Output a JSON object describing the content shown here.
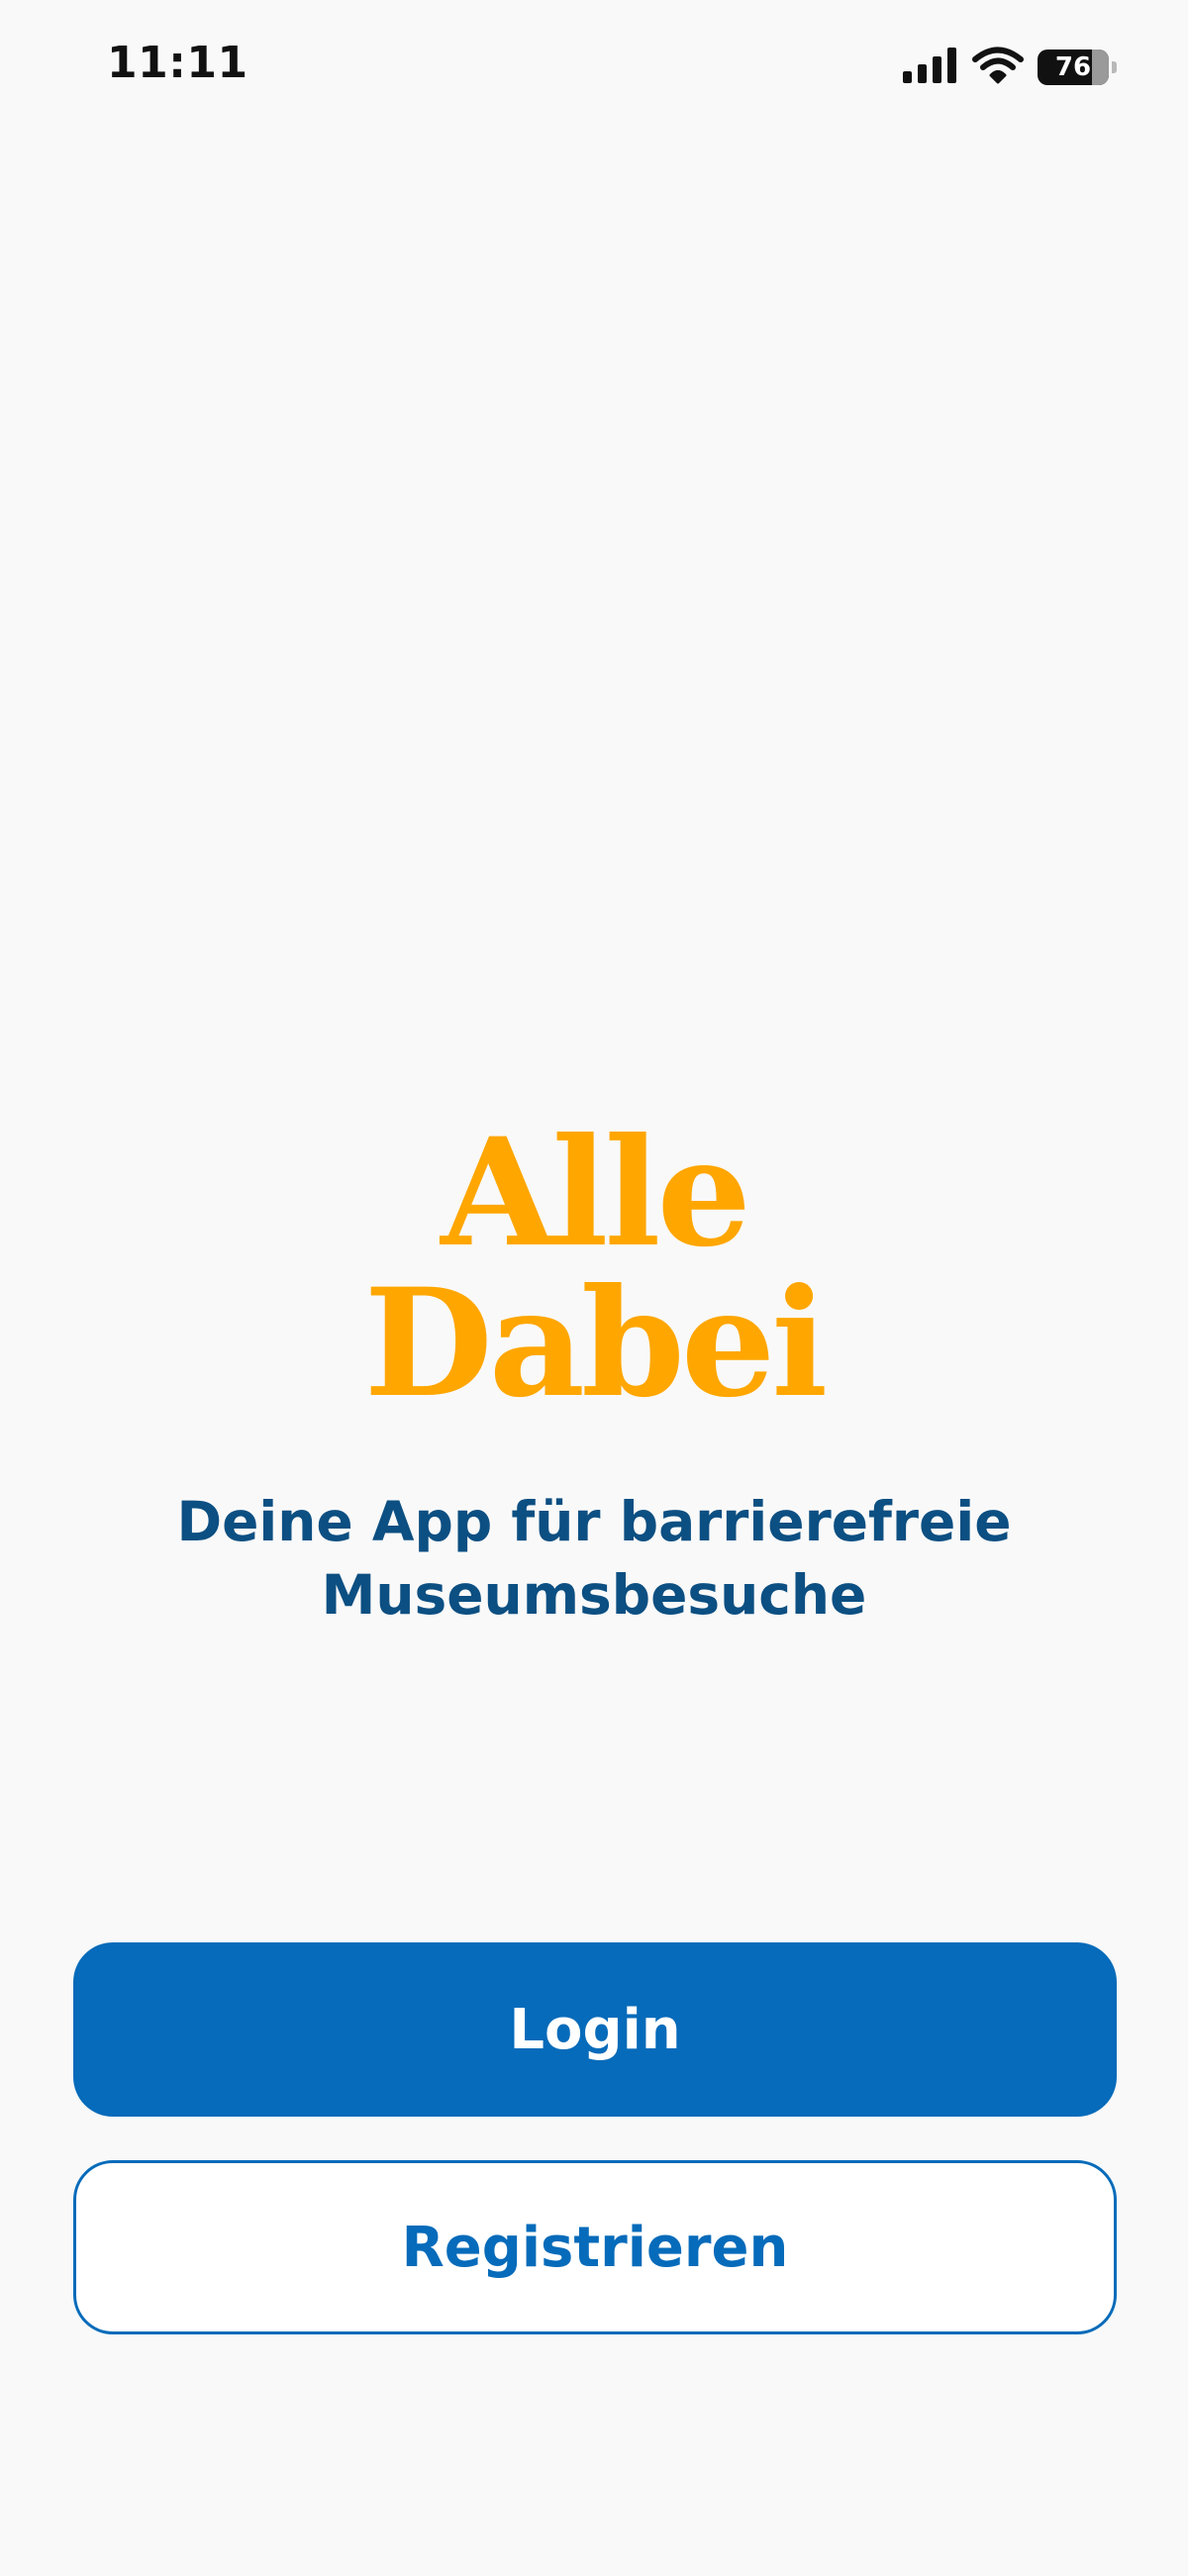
{
  "status_bar": {
    "time": "11:11",
    "battery_level": "76",
    "battery_fraction": 0.76,
    "signal_icon": "cellular-signal-icon",
    "wifi_icon": "wifi-icon",
    "battery_icon": "battery-icon"
  },
  "logo": {
    "line1": "Alle",
    "line2": "Dabei"
  },
  "tagline": {
    "line1": "Deine App für barrierefreie",
    "line2": "Museumsbesuche"
  },
  "buttons": {
    "login_label": "Login",
    "register_label": "Registrieren"
  },
  "colors": {
    "background": "#f9f9f9",
    "logo": "#ffa600",
    "tagline": "#0c4f82",
    "primary": "#066bba"
  }
}
